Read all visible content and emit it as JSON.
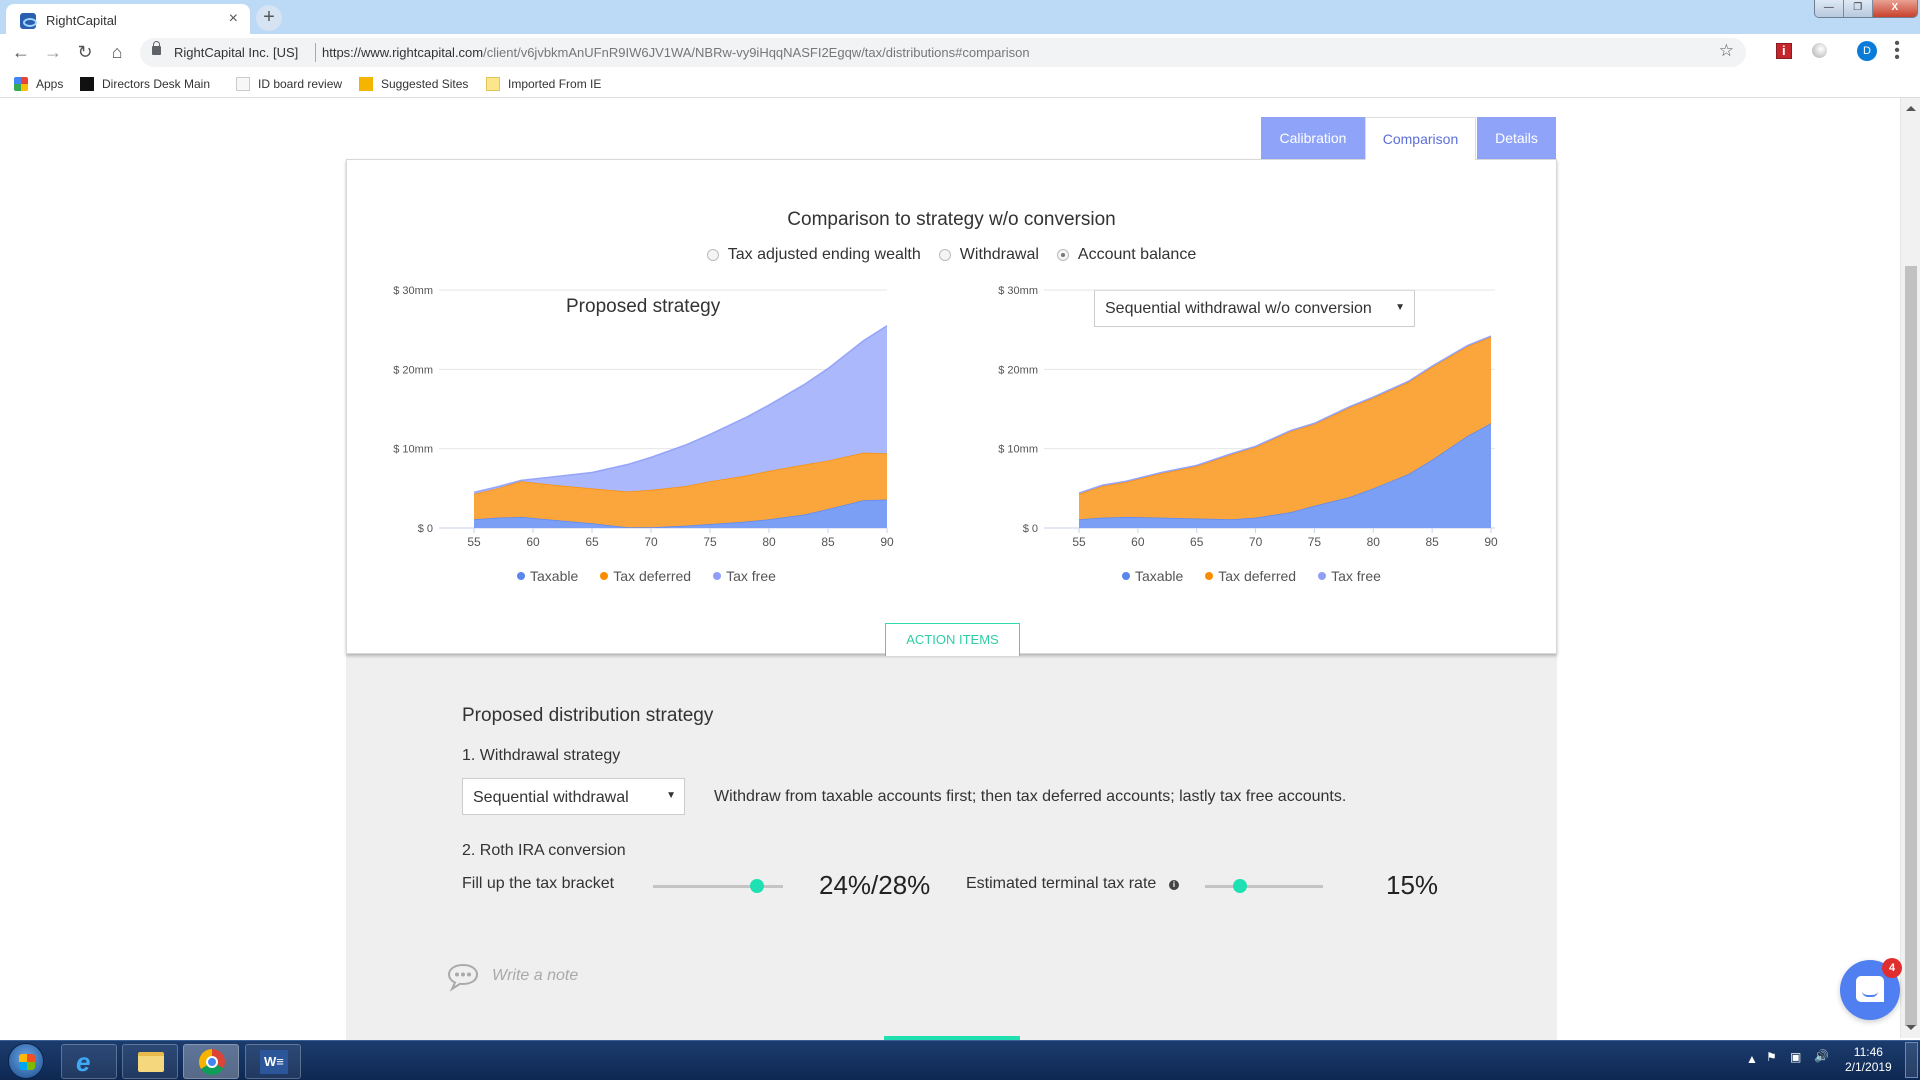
{
  "browser": {
    "tab_title": "RightCapital",
    "new_tab": "+",
    "close_tab": "×",
    "site_identity": "RightCapital Inc. [US]",
    "url_host": "https://www.rightcapital.com",
    "url_path": "/client/v6jvbkmAnUFnR9IW6JV1WA/NBRw-vy9iHqqNASFI2Egqw/tax/distributions#comparison",
    "profile_initial": "D",
    "bookmarks": [
      "Apps",
      "Directors Desk Main",
      "ID board review",
      "Suggested Sites",
      "Imported From IE"
    ]
  },
  "tabs": [
    {
      "label": "Calibration",
      "active": false
    },
    {
      "label": "Comparison",
      "active": true
    },
    {
      "label": "Details",
      "active": false
    }
  ],
  "comparison": {
    "title": "Comparison to strategy w/o conversion",
    "view_options": [
      {
        "label": "Tax adjusted ending wealth",
        "selected": false
      },
      {
        "label": "Withdrawal",
        "selected": false
      },
      {
        "label": "Account balance",
        "selected": true
      }
    ],
    "left_title": "Proposed strategy",
    "right_select": "Sequential withdrawal w/o conversion",
    "action_items": "ACTION ITEMS"
  },
  "colors": {
    "taxable": "#5b86ee",
    "tax_deferred": "#fb8c00",
    "tax_free": "#8f9ff8",
    "accent_green": "#1fe0b2",
    "tab_inactive": "#8fa3f8"
  },
  "chart_data": [
    {
      "type": "area",
      "title": "Proposed strategy",
      "stacked": true,
      "x": [
        55,
        57,
        59,
        62,
        65,
        68,
        70,
        73,
        75,
        78,
        80,
        83,
        85,
        88,
        90
      ],
      "xticks": [
        55,
        60,
        65,
        70,
        75,
        80,
        85,
        90
      ],
      "yticks": [
        0,
        10,
        20,
        30
      ],
      "ytick_labels": [
        "$ 0",
        "$ 10mm",
        "$ 20mm",
        "$ 30mm"
      ],
      "ylim": [
        0,
        30
      ],
      "yunit": "$mm",
      "grid": true,
      "legend_position": "bottom",
      "series": [
        {
          "name": "Taxable",
          "values": [
            1.1,
            1.3,
            1.4,
            1.0,
            0.6,
            0.1,
            0.1,
            0.3,
            0.5,
            0.8,
            1.1,
            1.7,
            2.4,
            3.5,
            3.6
          ]
        },
        {
          "name": "Tax deferred",
          "values": [
            3.2,
            3.7,
            4.5,
            4.4,
            4.4,
            4.5,
            4.7,
            5.0,
            5.4,
            5.8,
            6.1,
            6.3,
            6.1,
            6.0,
            5.8
          ]
        },
        {
          "name": "Tax free",
          "values": [
            0.2,
            0.2,
            0.1,
            1.1,
            2.0,
            3.4,
            4.1,
            5.2,
            5.9,
            7.3,
            8.3,
            10.1,
            11.6,
            14.1,
            16.1
          ]
        }
      ]
    },
    {
      "type": "area",
      "title": "Sequential withdrawal w/o conversion",
      "stacked": true,
      "x": [
        55,
        57,
        59,
        62,
        65,
        68,
        70,
        73,
        75,
        78,
        80,
        83,
        85,
        88,
        90
      ],
      "xticks": [
        55,
        60,
        65,
        70,
        75,
        80,
        85,
        90
      ],
      "yticks": [
        0,
        10,
        20,
        30
      ],
      "ytick_labels": [
        "$ 0",
        "$ 10mm",
        "$ 20mm",
        "$ 30mm"
      ],
      "ylim": [
        0,
        30
      ],
      "yunit": "$mm",
      "grid": true,
      "legend_position": "bottom",
      "series": [
        {
          "name": "Taxable",
          "values": [
            1.1,
            1.3,
            1.4,
            1.3,
            1.2,
            1.1,
            1.3,
            2.0,
            2.8,
            3.9,
            5.0,
            6.8,
            8.6,
            11.6,
            13.2
          ]
        },
        {
          "name": "Tax deferred",
          "values": [
            3.2,
            4.0,
            4.4,
            5.6,
            6.6,
            8.2,
            8.9,
            10.2,
            10.3,
            11.3,
            11.4,
            11.6,
            11.7,
            11.3,
            10.9
          ]
        },
        {
          "name": "Tax free",
          "values": [
            0.1,
            0.1,
            0.1,
            0.1,
            0.1,
            0.1,
            0.1,
            0.1,
            0.1,
            0.1,
            0.1,
            0.1,
            0.1,
            0.1,
            0.1
          ]
        }
      ]
    }
  ],
  "distribution": {
    "title": "Proposed distribution strategy",
    "withdrawal_label": "1. Withdrawal strategy",
    "withdrawal_select": "Sequential withdrawal",
    "withdrawal_desc": "Withdraw from taxable accounts first; then tax deferred accounts; lastly tax free accounts.",
    "roth_label": "2. Roth IRA conversion",
    "fill_label": "Fill up the tax bracket",
    "fill_value": "24%/28%",
    "fill_slider_fraction": 0.8,
    "terminal_label": "Estimated terminal tax rate",
    "terminal_value": "15%",
    "terminal_slider_fraction": 0.3,
    "note_placeholder": "Write a note"
  },
  "chat": {
    "badge_count": "4"
  },
  "taskbar": {
    "time": "11:46",
    "date": "2/1/2019"
  }
}
